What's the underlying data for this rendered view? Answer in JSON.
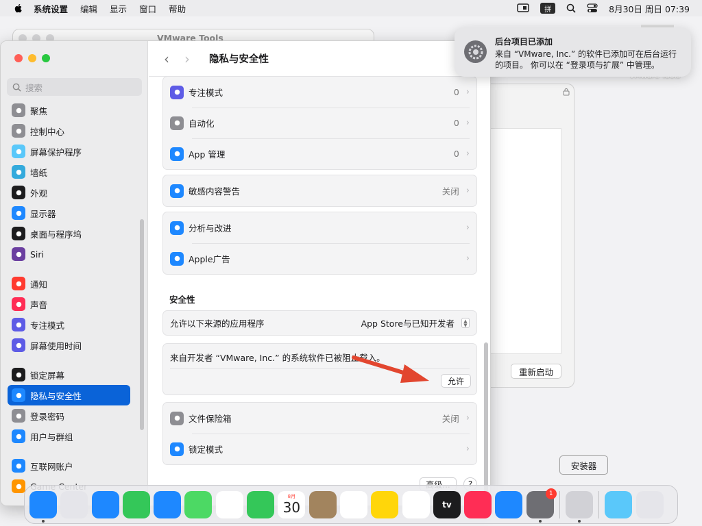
{
  "menubar": {
    "app_name": "系统设置",
    "items": [
      "编辑",
      "显示",
      "窗口",
      "帮助"
    ],
    "datetime": "8月30日 周日 07:39",
    "ime_label": "拼"
  },
  "bg_window": {
    "title": "VMware Tools",
    "restart_label": "重新启动",
    "desktop_icon_label": "VMware Tools"
  },
  "sidebar": {
    "search_placeholder": "搜索",
    "groups": [
      [
        {
          "label": "聚焦",
          "icon": "spotlight-icon",
          "color": "#8e8e93"
        },
        {
          "label": "控制中心",
          "icon": "control-center-icon",
          "color": "#8e8e93"
        },
        {
          "label": "屏幕保护程序",
          "icon": "screensaver-icon",
          "color": "#5ac8fa"
        },
        {
          "label": "墙纸",
          "icon": "wallpaper-icon",
          "color": "#34aadc"
        },
        {
          "label": "外观",
          "icon": "appearance-icon",
          "color": "#1c1c1e"
        },
        {
          "label": "显示器",
          "icon": "display-icon",
          "color": "#1e88ff"
        },
        {
          "label": "桌面与程序坞",
          "icon": "dock-icon",
          "color": "#1c1c1e"
        },
        {
          "label": "Siri",
          "icon": "siri-icon",
          "color": "#6b3fa0"
        }
      ],
      [
        {
          "label": "通知",
          "icon": "notifications-icon",
          "color": "#ff3b30"
        },
        {
          "label": "声音",
          "icon": "sound-icon",
          "color": "#ff2d55"
        },
        {
          "label": "专注模式",
          "icon": "focus-icon",
          "color": "#5e5ce6"
        },
        {
          "label": "屏幕使用时间",
          "icon": "screen-time-icon",
          "color": "#5e5ce6"
        }
      ],
      [
        {
          "label": "锁定屏幕",
          "icon": "lock-screen-icon",
          "color": "#1c1c1e"
        },
        {
          "label": "隐私与安全性",
          "icon": "hand-icon",
          "color": "#1e88ff",
          "selected": true
        },
        {
          "label": "登录密码",
          "icon": "password-icon",
          "color": "#8e8e93"
        },
        {
          "label": "用户与群组",
          "icon": "users-icon",
          "color": "#1e88ff"
        }
      ],
      [
        {
          "label": "互联网账户",
          "icon": "internet-accounts-icon",
          "color": "#1e88ff"
        },
        {
          "label": "Game Center",
          "icon": "game-center-icon",
          "color": "#ff9500"
        }
      ]
    ]
  },
  "content": {
    "title": "隐私与安全性",
    "card1": [
      {
        "label": "专注模式",
        "value": "0",
        "icon": "focus-icon",
        "color": "#5e5ce6"
      },
      {
        "label": "自动化",
        "value": "0",
        "icon": "gear-icon",
        "color": "#8e8e93"
      },
      {
        "label": "App 管理",
        "value": "0",
        "icon": "app-store-icon",
        "color": "#1e88ff"
      }
    ],
    "card2": [
      {
        "label": "敏感内容警告",
        "value": "关闭",
        "icon": "eye-icon",
        "color": "#1e88ff"
      }
    ],
    "card3": [
      {
        "label": "分析与改进",
        "value": "",
        "icon": "analytics-icon",
        "color": "#1e88ff"
      },
      {
        "label": "Apple广告",
        "value": "",
        "icon": "ads-icon",
        "color": "#1e88ff"
      }
    ],
    "security": {
      "heading": "安全性",
      "allow_from_label": "允许以下来源的应用程序",
      "allow_from_value": "App Store与已知开发者",
      "blocked_message": "来自开发者 “VMware, Inc.” 的系统软件已被阻止载入。",
      "allow_button": "允许"
    },
    "card4": [
      {
        "label": "文件保险箱",
        "value": "关闭",
        "icon": "filevault-icon",
        "color": "#8e8e93"
      },
      {
        "label": "锁定模式",
        "value": "",
        "icon": "hand-icon",
        "color": "#1e88ff"
      }
    ],
    "advanced_button": "高级...",
    "help_button": "?"
  },
  "notification": {
    "title": "后台项目已添加",
    "body": "来自 “VMware, Inc.” 的软件已添加可在后台运行的项目。 你可以在 “登录项与扩展” 中管理。"
  },
  "tooltip": "安装器",
  "dock": {
    "calendar_month": "8月",
    "calendar_day": "30",
    "tv_label": "tv",
    "settings_badge": "1",
    "apps": [
      {
        "name": "finder-icon",
        "color": "#1e88ff",
        "dot": true
      },
      {
        "name": "launchpad-icon",
        "color": "#e5e5ea"
      },
      {
        "name": "safari-icon",
        "color": "#1e88ff"
      },
      {
        "name": "messages-icon",
        "color": "#34c759"
      },
      {
        "name": "mail-icon",
        "color": "#1e88ff"
      },
      {
        "name": "maps-icon",
        "color": "#4cd964"
      },
      {
        "name": "photos-icon",
        "color": "#ffffff"
      },
      {
        "name": "facetime-icon",
        "color": "#34c759"
      },
      {
        "name": "calendar-icon",
        "color": "#ffffff"
      },
      {
        "name": "contacts-icon",
        "color": "#a2845e"
      },
      {
        "name": "reminders-icon",
        "color": "#ffffff"
      },
      {
        "name": "notes-icon",
        "color": "#ffd60a"
      },
      {
        "name": "freeform-icon",
        "color": "#ffffff"
      },
      {
        "name": "apple-tv-icon",
        "color": "#1c1c1e"
      },
      {
        "name": "music-icon",
        "color": "#ff2d55"
      },
      {
        "name": "app-store-icon",
        "color": "#1e88ff"
      },
      {
        "name": "system-settings-icon",
        "color": "#6e6e73",
        "dot": true
      }
    ],
    "installer": {
      "name": "installer-icon",
      "color": "#d1d1d6",
      "dot": true
    },
    "downloads": {
      "name": "downloads-icon",
      "color": "#5ac8fa"
    },
    "trash": {
      "name": "trash-icon",
      "color": "#e5e5ea"
    }
  }
}
